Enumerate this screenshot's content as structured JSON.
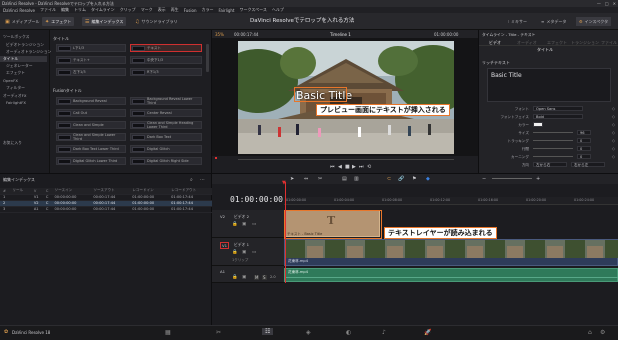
{
  "window": {
    "title": "DaVinci Resolve - DaVinci Resolveでテロップを入れる方法",
    "min": "—",
    "max": "□",
    "close": "✕"
  },
  "menu": [
    "DaVinci Resolve",
    "ファイル",
    "編集",
    "トリム",
    "タイムライン",
    "クリップ",
    "マーク",
    "表示",
    "再生",
    "Fusion",
    "カラー",
    "Fairlight",
    "ワークスペース",
    "ヘルプ"
  ],
  "toolbar": {
    "media_pool": "メディアプール",
    "effects": "エフェクト",
    "edit_index": "編集インデックス",
    "sound_library": "サウンドライブラリ",
    "project_title": "DaVinci Resolveでテロップを入れる方法",
    "mixer": "ミキサー",
    "metadata": "メタデータ",
    "inspector": "インスペクタ"
  },
  "effects_tree": {
    "toolbox": "ツールボックス",
    "video_transitions": "ビデオトランジション",
    "audio_transitions": "オーディオトランジション",
    "titles": "タイトル",
    "generators": "ジェネレーター",
    "effects": "エフェクト",
    "openfx": "OpenFX",
    "filters": "フィルター",
    "audio_fx": "オーディオFX",
    "fairlight_fx": "FairlightFX",
    "favorites": "お気に入り"
  },
  "titles_panel": {
    "header": "タイトル",
    "items": [
      "L下1/3",
      "左下1/3",
      "R下1/3",
      "スクロール",
      "テキスト",
      "テキスト+",
      "Basic Title",
      "中央下1/3"
    ]
  },
  "fusion_panel": {
    "header": "Fusionタイトル",
    "items": [
      "Background Reveal",
      "Background Reveal Lower Third",
      "Call Out",
      "Center Reveal",
      "Clean and Simple",
      "Clean and Simple Heading Lower Third",
      "Clean and Simple Lower Third",
      "Dark Box Text",
      "Dark Box Text Lower Third",
      "Digital Glitch",
      "Digital Glitch Lower Third",
      "Digital Glitch Right Side",
      "Dual Lines Lower Third",
      "Draw On 1 Line"
    ]
  },
  "viewer": {
    "zoom": "35%",
    "timecode_left": "00:00:17:44",
    "timeline_name": "Timeline 1",
    "timecode_right": "01:00:00:00",
    "overlay_text": "Basic Title"
  },
  "callouts": {
    "preview": "プレビュー画面にテキストが挿入される",
    "layer": "テキストレイヤーが読み込まれる"
  },
  "inspector": {
    "header": "タイムライン - Title - テキスト",
    "tab_video": "ビデオ",
    "tab_transition": "トランジション",
    "tab_file": "ファイル",
    "sub_title": "タイトル",
    "section": "リッチテキスト",
    "text_value": "Basic Title",
    "font_label": "フォント",
    "font_value": "Open Sans",
    "style_label": "フォントフェイス",
    "style_value": "Bold",
    "color_label": "カラー",
    "size_label": "サイズ",
    "size_value": "96",
    "tracking_label": "トラッキング",
    "tracking_value": "0",
    "line_label": "行間",
    "line_value": "0",
    "kern_label": "カーニング",
    "kern_value": "0",
    "align_label": "揃え",
    "anchor_label": "アンカー",
    "dir_label": "方向",
    "dir_value": "左から右",
    "dir_value2": "右から左"
  },
  "edit_index": {
    "header": "編集インデックス",
    "columns": [
      "#",
      "リール",
      "V",
      "C",
      "ソースイン",
      "ソースアウト",
      "レコードイン",
      "レコードアウト"
    ],
    "rows": [
      [
        "1",
        "",
        "V1",
        "C",
        "00:00:00:00",
        "00:00:17:44",
        "01:00:00:00",
        "01:00:17:44"
      ],
      [
        "2",
        "",
        "V2",
        "C",
        "00:00:00:00",
        "00:00:17:44",
        "01:00:00:00",
        "01:00:17:44"
      ],
      [
        "3",
        "",
        "A1",
        "C",
        "00:00:00:00",
        "00:00:17:44",
        "01:00:00:00",
        "01:00:17:44"
      ]
    ]
  },
  "timeline": {
    "timecode": "01:00:00:00",
    "ruler": [
      "01:00:00:00",
      "01:00:04:00",
      "01:00:08:00",
      "01:00:12:00",
      "01:00:16:00",
      "01:00:20:00",
      "01:00:24:00"
    ],
    "v2_name": "ビデオ 2",
    "v1_name": "ビデオ 1",
    "a1_name": "A1",
    "v2_id": "V2",
    "v1_id": "V1",
    "a1_vol": "2.0",
    "title_clip": "テキスト - Basic Title",
    "video_clip": "花東林.mp4",
    "audio_clip": "花東林.mp4",
    "clip_count": "1クリップ"
  },
  "footer": {
    "app": "DaVinci Resolve 18"
  }
}
